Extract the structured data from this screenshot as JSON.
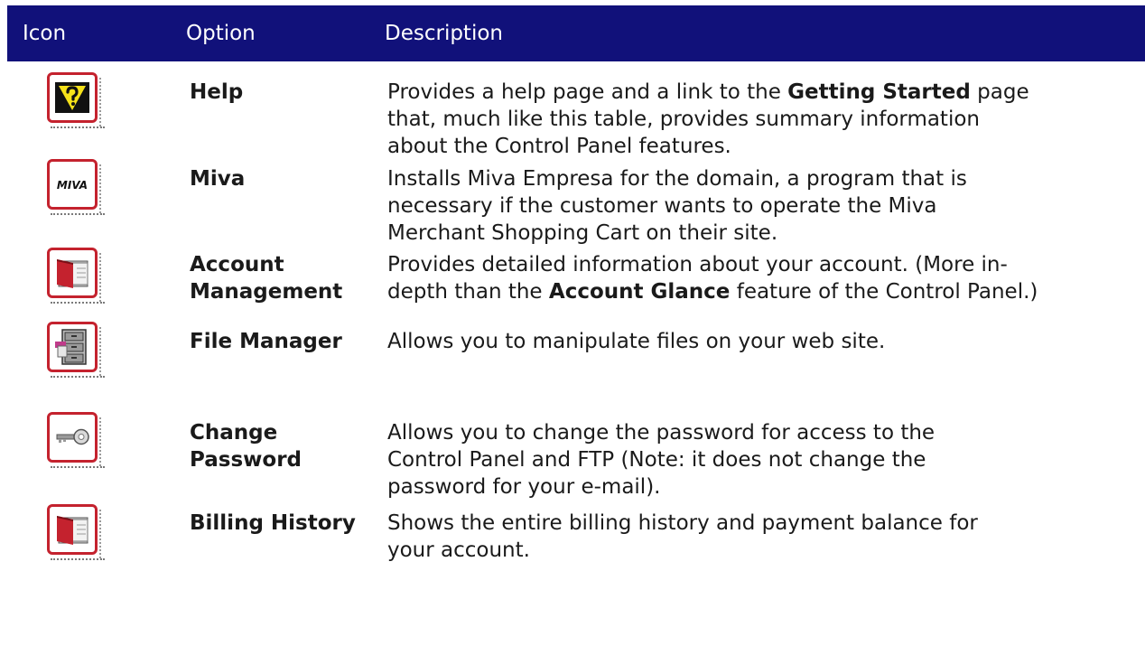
{
  "header": {
    "icon": "Icon",
    "option": "Option",
    "description": "Description"
  },
  "rows": [
    {
      "icon": "help-icon",
      "option_line1": "Help",
      "option_line2": "",
      "desc": {
        "line1_pre": "Provides a help page and a link to the ",
        "line1_bold": "Getting Started",
        "line1_post": " page",
        "line2": "that, much like this table, provides summary information",
        "line3": "about the Control Panel features."
      }
    },
    {
      "icon": "miva-icon",
      "icon_text": "MIVA",
      "option_line1": "Miva",
      "option_line2": "",
      "desc": {
        "line1": "Installs Miva Empresa for the domain, a program that is",
        "line2": "necessary if the customer wants to operate the Miva",
        "line3": "Merchant Shopping Cart on their site."
      }
    },
    {
      "icon": "book-icon",
      "option_line1": "Account",
      "option_line2": "Management",
      "desc": {
        "line1": "Provides detailed information about your account.  (More in-",
        "line2_pre": "depth than the ",
        "line2_bold": "Account Glance",
        "line2_post": " feature of the Control Panel.)"
      }
    },
    {
      "icon": "file-cabinet-icon",
      "option_line1": "File Manager",
      "option_line2": "",
      "desc": {
        "line1": "Allows you to manipulate files on your web site."
      }
    },
    {
      "icon": "key-icon",
      "option_line1": "Change",
      "option_line2": "Password",
      "desc": {
        "line1": "Allows you to change the password for access to the",
        "line2": "Control Panel and FTP (Note:  it does not change the",
        "line3": "password for your e-mail)."
      }
    },
    {
      "icon": "book-icon",
      "option_line1": "Billing History",
      "option_line2": "",
      "desc": {
        "line1": "Shows the entire billing history and payment balance for",
        "line2": "your account."
      }
    }
  ]
}
